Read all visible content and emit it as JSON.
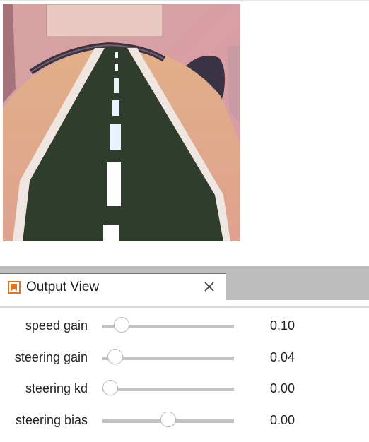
{
  "output_view": {
    "title": "Output View"
  },
  "sliders": [
    {
      "label": "speed gain",
      "value": "0.10",
      "level": 0.1
    },
    {
      "label": "steering gain",
      "value": "0.04",
      "level": 0.04
    },
    {
      "label": "steering kd",
      "value": "0.00",
      "level": 0.0
    },
    {
      "label": "steering bias",
      "value": "0.00",
      "level": 0.5
    }
  ],
  "colors": {
    "tab_accent": "#2a86d9",
    "panel_bg": "#bdbdbd",
    "slider_track": "#c3c3c3",
    "icon_orange": "#e8731a"
  },
  "icons": {
    "tab": "bookmark-icon",
    "close": "close-icon"
  }
}
